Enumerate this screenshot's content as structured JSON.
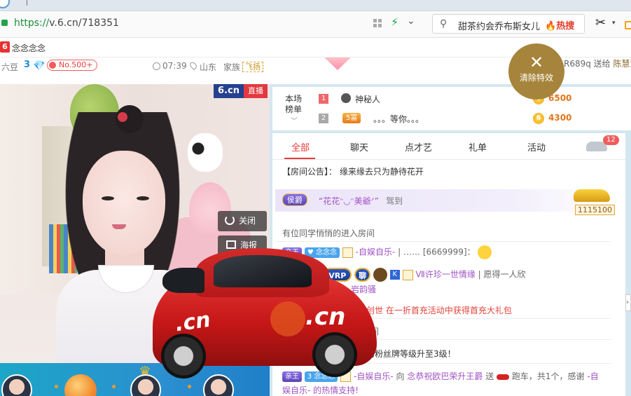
{
  "browser": {
    "url_protocol": "https://",
    "url_rest": "v.6.cn/718351",
    "search_text": "甜茶约会乔布斯女儿",
    "hot_label": "热搜"
  },
  "site": {
    "logo_char": "6",
    "room_name": "念念念念"
  },
  "streamer": {
    "liudou_label": "六豆",
    "liudou_count": "3",
    "rank_label": "No.500+",
    "time": "07:39",
    "location": "山东",
    "family_label": "家族",
    "family_name": "飞扬"
  },
  "gift_notice": {
    "text": "R689q 送给",
    "name": "陈慧慧"
  },
  "clear_effects_label": "清除特效",
  "video": {
    "logo": "6.cn",
    "live_label": "直播",
    "close_label": "关闭",
    "poster_label": "海报"
  },
  "ranking": {
    "title": "本场榜单",
    "rows": [
      {
        "num": "1",
        "name": "神秘人",
        "badge": "",
        "value": "6500"
      },
      {
        "num": "2",
        "name": "。。。等你。。。",
        "badge": "5富",
        "value": "4300"
      }
    ]
  },
  "chat": {
    "tabs": [
      "全部",
      "聊天",
      "点才艺",
      "礼单",
      "活动"
    ],
    "car_count": "12",
    "notice": "【房间公告】： 缘来缘去只为静待花开",
    "arrival": {
      "badge": "侯爵",
      "name": "“花花ᵔ◡ᵔ美爺ᐟ”",
      "text": "驾到",
      "car_count": "1115100"
    },
    "lines": {
      "enter": "有位同学悄悄的进入房间",
      "msg1_badge": "亲王",
      "msg1_name": "-自娱自乐-",
      "msg1_text": "| …… [6669999]：",
      "msg2_name": "Ⅶ许珍一世情缘",
      "msg2_text": "| 愿得一人欣",
      "msg2_cont": "岩韵骚",
      "msg3_prefix": "创世",
      "msg3_text": "在一折首充活动中获得首充大礼包",
      "msg4_text": "间",
      "msg5_text": "的粉丝牌等级升至3级！",
      "msg6_badge": "亲王",
      "msg6_name": "-自娱自乐-",
      "msg6_to": "向",
      "msg6_target": "念恭祝欧巴荣升王爵",
      "msg6_send": "送",
      "msg6_gift": "跑车，共1个，感谢",
      "msg6_thanks": "-自",
      "msg7_text": "娱自乐-  的热情支持!"
    }
  },
  "overlay_car": {
    "brand": ".cn",
    "brand_side": ".cn"
  },
  "badge_text": {
    "vrp": "VRP",
    "k": "K",
    "pin": "聊"
  }
}
